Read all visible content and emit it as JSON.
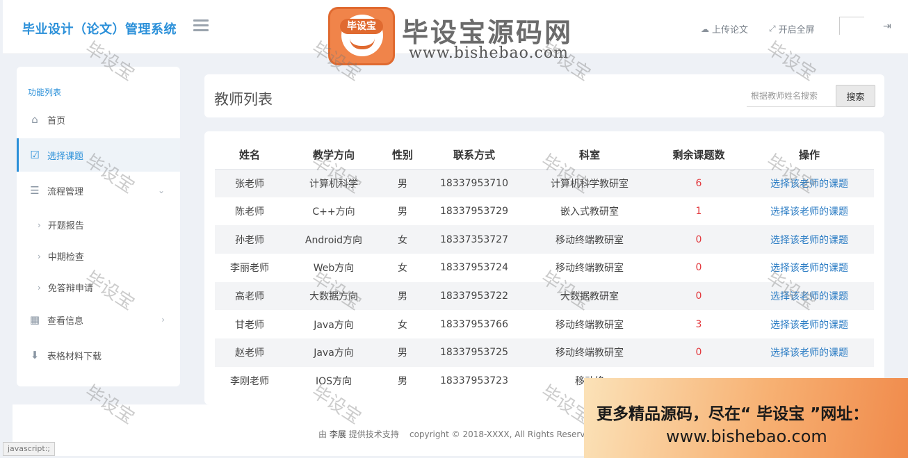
{
  "header": {
    "brand": "毕业设计（论文）管理系统",
    "upload_label": "上传论文",
    "fullscreen_label": "开启全屏"
  },
  "logo": {
    "badge_text": "毕设宝",
    "title": "毕设宝源码网",
    "url": "www.bishebao.com"
  },
  "sidebar": {
    "title": "功能列表",
    "items": [
      {
        "label": "首页",
        "icon": "home-icon"
      },
      {
        "label": "选择课题",
        "icon": "checkbox-icon"
      },
      {
        "label": "流程管理",
        "icon": "list-icon"
      },
      {
        "label": "开题报告"
      },
      {
        "label": "中期检查"
      },
      {
        "label": "免答辩申请"
      },
      {
        "label": "查看信息",
        "icon": "calendar-icon"
      },
      {
        "label": "表格材料下载",
        "icon": "download-icon"
      }
    ]
  },
  "panel": {
    "title": "教师列表",
    "search_placeholder": "根据教师姓名搜索",
    "search_button": "搜索"
  },
  "table": {
    "headers": [
      "姓名",
      "教学方向",
      "性别",
      "联系方式",
      "科室",
      "剩余课题数",
      "操作"
    ],
    "rows": [
      [
        "张老师",
        "计算机科学",
        "男",
        "18337953710",
        "计算机科学教研室",
        "6",
        "选择该老师的课题"
      ],
      [
        "陈老师",
        "C++方向",
        "男",
        "18337953729",
        "嵌入式教研室",
        "1",
        "选择该老师的课题"
      ],
      [
        "孙老师",
        "Android方向",
        "女",
        "18337353727",
        "移动终端教研室",
        "0",
        "选择该老师的课题"
      ],
      [
        "李丽老师",
        "Web方向",
        "女",
        "18337953724",
        "移动终端教研室",
        "0",
        "选择该老师的课题"
      ],
      [
        "高老师",
        "大数据方向",
        "男",
        "18337953722",
        "大数据教研室",
        "0",
        "选择该老师的课题"
      ],
      [
        "甘老师",
        "Java方向",
        "女",
        "18337953766",
        "移动终端教研室",
        "3",
        "选择该老师的课题"
      ],
      [
        "赵老师",
        "Java方向",
        "男",
        "18337953725",
        "移动终端教研室",
        "0",
        "选择该老师的课题"
      ],
      [
        "李刚老师",
        "IOS方向",
        "男",
        "18337953723",
        "移动终",
        "",
        ""
      ]
    ]
  },
  "footer": {
    "prefix": "由",
    "author": "李展",
    "suffix": "提供技术支持",
    "copyright": "copyright © 2018-XXXX, All Rights Reserve"
  },
  "status_bar": "javascript:;",
  "promo": {
    "line1": "更多精品源码，尽在“ 毕设宝 ”网址：",
    "line2": "www.bishebao.com"
  },
  "watermark": "毕设宝",
  "colors": {
    "accent": "#2b90d9",
    "red_count": "#e2363b",
    "link": "#2b7cc4"
  }
}
